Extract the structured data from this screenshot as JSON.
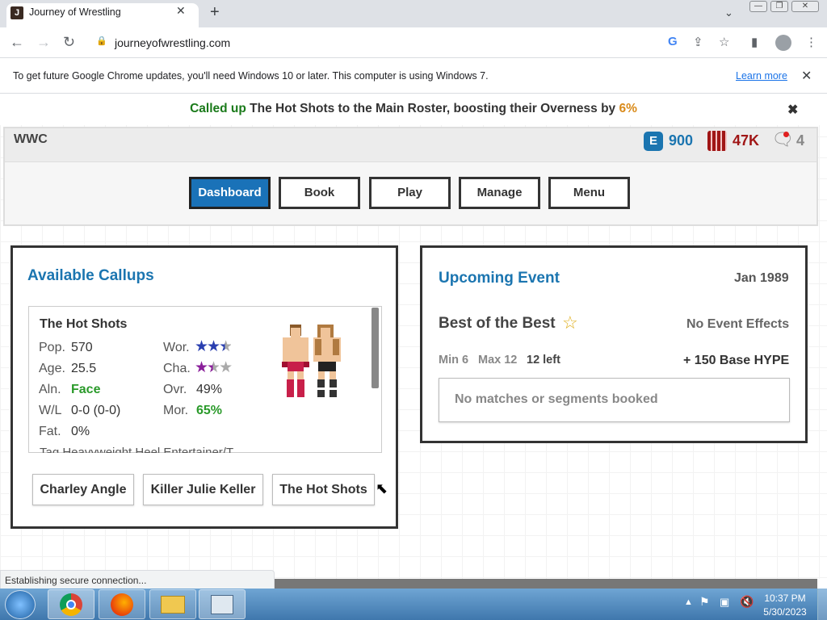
{
  "browser": {
    "tab_title": "Journey of Wrestling",
    "favicon_letter": "J",
    "url": "journeyofwrestling.com",
    "info_text": "To get future Google Chrome updates, you'll need Windows 10 or later. This computer is using Windows 7.",
    "learn_more": "Learn more",
    "status_text": "Establishing secure connection..."
  },
  "notification": {
    "prefix": "Called up",
    "middle": "The Hot Shots to the Main Roster, boosting their Overness by",
    "value": "6%"
  },
  "header": {
    "promotion": "WWC",
    "tokens": "900",
    "money": "47K",
    "messages": "4"
  },
  "nav": [
    "Dashboard",
    "Book",
    "Play",
    "Manage",
    "Menu"
  ],
  "callups": {
    "title": "Available Callups",
    "wrestler": {
      "name": "The Hot Shots",
      "pop_label": "Pop.",
      "pop": "570",
      "age_label": "Age.",
      "age": "25.5",
      "aln_label": "Aln.",
      "aln": "Face",
      "wl_label": "W/L",
      "wl": "0-0 (0-0)",
      "fat_label": "Fat.",
      "fat": "0%",
      "wor_label": "Wor.",
      "wor_stars": 2.5,
      "cha_label": "Cha.",
      "cha_stars": 1.5,
      "ovr_label": "Ovr.",
      "ovr": "49%",
      "mor_label": "Mor.",
      "mor": "65%",
      "cut_line": "Tag Heavyweight Heel Entertainer/T"
    },
    "buttons": [
      "Charley Angle",
      "Killer Julie Keller",
      "The Hot Shots"
    ]
  },
  "upcoming": {
    "title": "Upcoming Event",
    "date": "Jan 1989",
    "event_name": "Best of the Best",
    "effects": "No Event Effects",
    "min": "Min 6",
    "max": "Max 12",
    "left": "12 left",
    "hype": "+ 150 Base HYPE",
    "empty": "No matches or segments booked"
  },
  "taskbar": {
    "time": "10:37 PM",
    "date": "5/30/2023"
  },
  "colors": {
    "accent_blue": "#1b75b0",
    "called_green": "#1a7a1a",
    "value_orange": "#d98a1a",
    "money_red": "#a01616"
  }
}
